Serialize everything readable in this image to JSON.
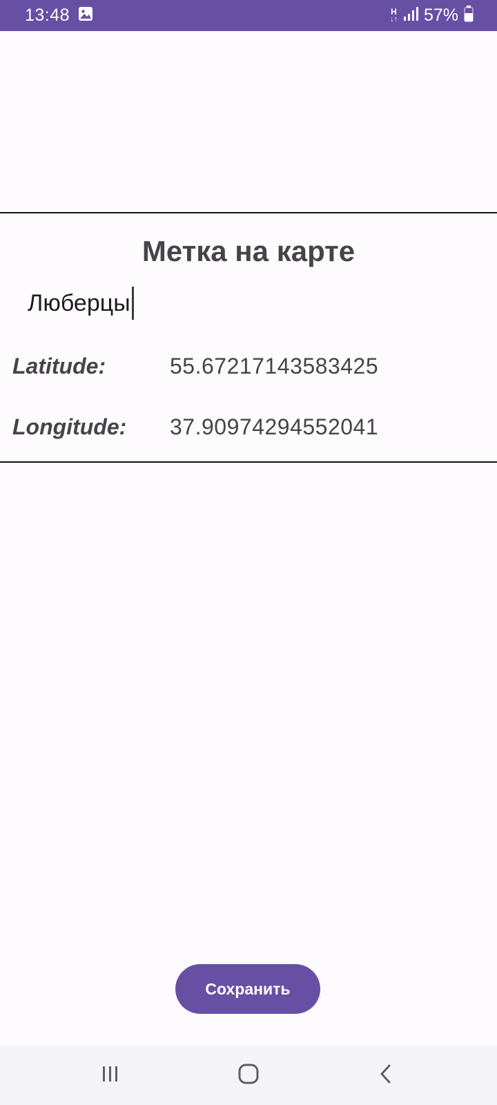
{
  "status_bar": {
    "time": "13:48",
    "network_letter": "H",
    "network_arrows": "↓↑",
    "battery_percent": "57%",
    "icons": [
      "gallery-icon",
      "data-transfer-icon",
      "signal-icon",
      "battery-icon"
    ]
  },
  "card": {
    "title": "Метка на карте",
    "name_value": "Люберцы",
    "latitude_label": "Latitude:",
    "latitude_value": "55.67217143583425",
    "longitude_label": "Longitude:",
    "longitude_value": "37.90974294552041"
  },
  "actions": {
    "save_label": "Сохранить"
  },
  "nav_bar": {
    "icons": [
      "recent-apps-icon",
      "home-icon",
      "back-icon"
    ]
  },
  "colors": {
    "accent": "#6750a4",
    "background": "#fefbff",
    "text": "#464349",
    "divider": "#111111",
    "nav_background": "#f4f4f6"
  }
}
